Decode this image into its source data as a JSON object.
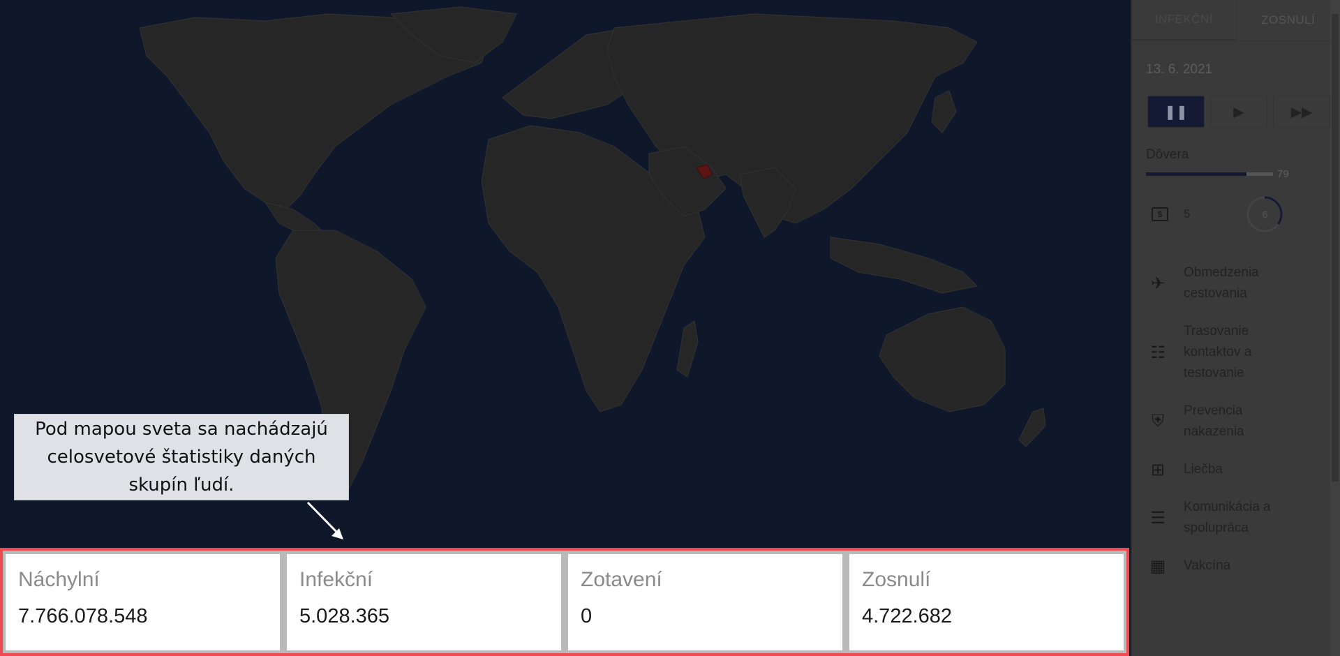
{
  "callout": {
    "text": "Pod mapou sveta sa nachádzajú celosvetové štatistiky daných skupín ľudí."
  },
  "stats": [
    {
      "label": "Náchylní",
      "value": "7.766.078.548"
    },
    {
      "label": "Infekční",
      "value": "5.028.365"
    },
    {
      "label": "Zotavení",
      "value": "0"
    },
    {
      "label": "Zosnulí",
      "value": "4.722.682"
    }
  ],
  "sidebar": {
    "tabs": [
      "INFEKČNÍ",
      "ZOSNULÍ"
    ],
    "date": "13. 6. 2021",
    "controls": {
      "pause": "❚❚",
      "play": "▶",
      "fast": "▶▶"
    },
    "trust": {
      "label": "Dôvera",
      "value": "79",
      "fraction": 0.79
    },
    "money": {
      "icon": "money-icon",
      "symbol": "$",
      "value": "5"
    },
    "cooldown": {
      "value": "6",
      "fraction": 0.35
    },
    "actions": [
      {
        "icon": "airplane-off-icon",
        "glyph": "✈",
        "label": "Obmedzenia cestovania"
      },
      {
        "icon": "contact-id-icon",
        "glyph": "☷",
        "label": "Trasovanie kontaktov a testovanie"
      },
      {
        "icon": "shield-icon",
        "glyph": "⛨",
        "label": "Prevencia nakazenia"
      },
      {
        "icon": "medical-plus-icon",
        "glyph": "⊞",
        "label": "Liečba"
      },
      {
        "icon": "chat-icon",
        "glyph": "☰",
        "label": "Komunikácia a spolupráca"
      },
      {
        "icon": "vaccine-icon",
        "glyph": "▦",
        "label": "Vakcína"
      }
    ]
  },
  "colors": {
    "highlight_border": "#ef4a52",
    "map_bg": "#0f172b",
    "land": "#262626",
    "infected_country": "#5e1414"
  }
}
